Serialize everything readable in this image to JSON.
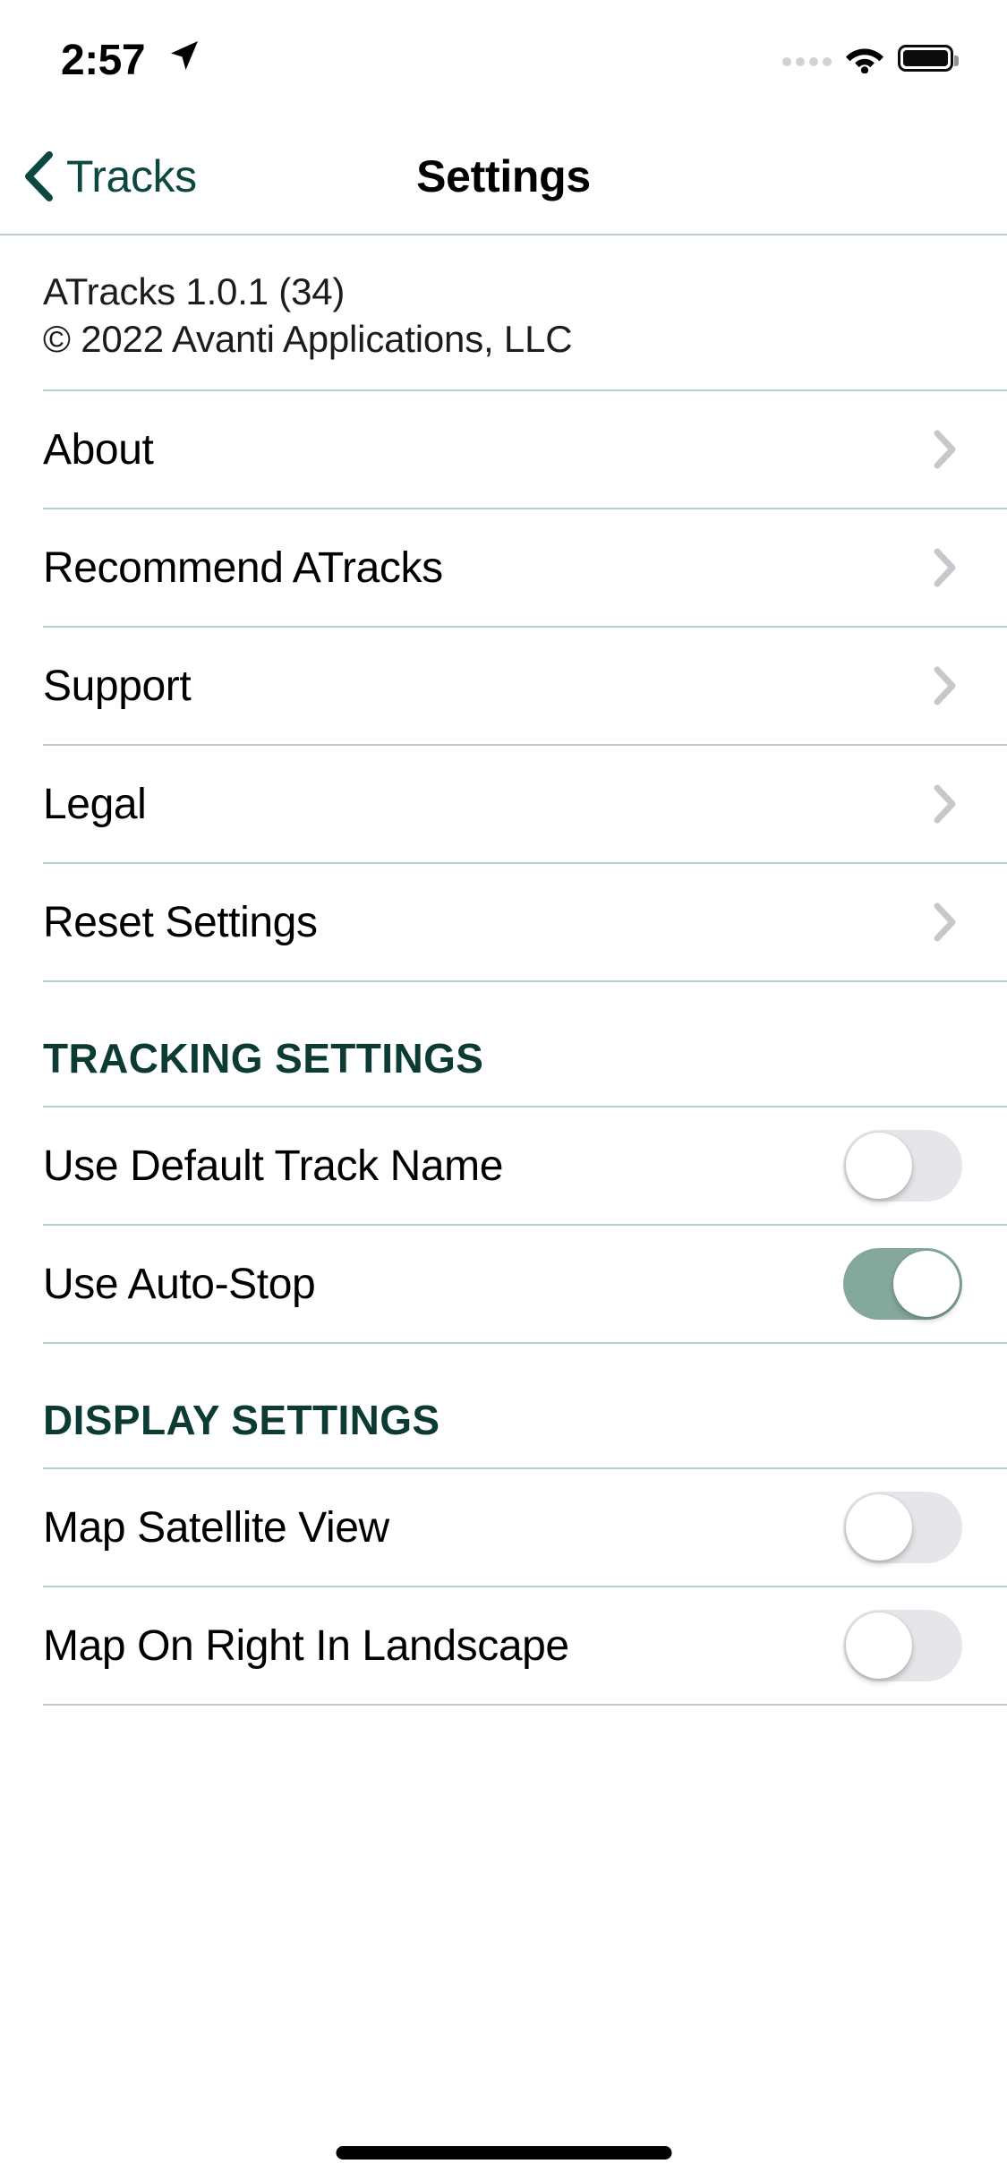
{
  "status_bar": {
    "time": "2:57",
    "location_icon": "location-arrow-icon",
    "signal_icon": "signal-dots-icon",
    "wifi_icon": "wifi-icon",
    "battery_icon": "battery-full-icon"
  },
  "nav": {
    "back_label": "Tracks",
    "back_icon": "chevron-left-icon",
    "title": "Settings"
  },
  "about_block": {
    "version": "ATracks 1.0.1 (34)",
    "copyright": "© 2022 Avanti Applications, LLC"
  },
  "menu_rows": [
    {
      "label": "About",
      "accessory": "chevron-right-icon"
    },
    {
      "label": "Recommend ATracks",
      "accessory": "chevron-right-icon"
    },
    {
      "label": "Support",
      "accessory": "chevron-right-icon"
    },
    {
      "label": "Legal",
      "accessory": "chevron-right-icon"
    },
    {
      "label": "Reset Settings",
      "accessory": "chevron-right-icon"
    }
  ],
  "tracking_section": {
    "header": "TRACKING SETTINGS",
    "rows": [
      {
        "label": "Use Default Track Name",
        "value": "off"
      },
      {
        "label": "Use Auto-Stop",
        "value": "on"
      }
    ]
  },
  "display_section": {
    "header": "DISPLAY SETTINGS",
    "rows": [
      {
        "label": "Map Satellite View",
        "value": "off"
      },
      {
        "label": "Map On Right In Landscape",
        "value": "off"
      }
    ]
  },
  "colors": {
    "accent_teal": "#0b4840",
    "section_header": "#0b3b33",
    "separator": "#b9cfcb",
    "switch_on": "#85a89d",
    "switch_off": "#e6e6ea",
    "chevron_grey": "#c7c7cc"
  },
  "home_indicator": "home-indicator"
}
